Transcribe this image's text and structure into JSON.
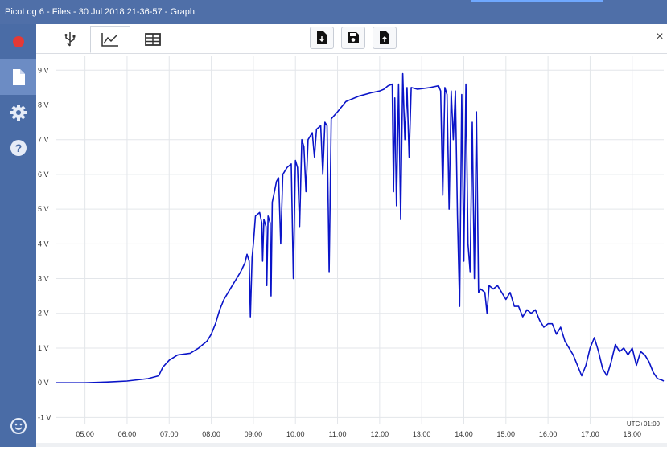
{
  "window": {
    "title": "PicoLog 6 - Files - 30 Jul 2018 21-36-57 - Graph"
  },
  "sidebar": {
    "items": [
      {
        "name": "record-icon",
        "color": "#e53935"
      },
      {
        "name": "file-icon",
        "active": true
      },
      {
        "name": "gear-icon"
      },
      {
        "name": "help-icon"
      },
      {
        "name": "smiley-icon"
      }
    ]
  },
  "toolbar": {
    "tabs": [
      {
        "name": "usb-icon"
      },
      {
        "name": "graph-icon",
        "active": true
      },
      {
        "name": "table-icon"
      }
    ],
    "buttons": [
      {
        "name": "open-file-icon"
      },
      {
        "name": "save-icon"
      },
      {
        "name": "export-icon"
      }
    ],
    "close_label": "×"
  },
  "chart_data": {
    "type": "line",
    "color": "#0a14c8",
    "timezone_label": "UTC+01:00",
    "x_ticks": [
      "05:00",
      "06:00",
      "07:00",
      "08:00",
      "09:00",
      "10:00",
      "11:00",
      "12:00",
      "13:00",
      "14:00",
      "15:00",
      "16:00",
      "17:00",
      "18:00"
    ],
    "y_ticks": [
      "-1 V",
      "0 V",
      "1 V",
      "2 V",
      "3 V",
      "4 V",
      "5 V",
      "6 V",
      "7 V",
      "8 V",
      "9 V"
    ],
    "xlim_hours": [
      4.3,
      18.75
    ],
    "ylim": [
      -1.2,
      9.4
    ],
    "grid": true,
    "series": [
      {
        "points": [
          [
            4.3,
            0
          ],
          [
            5.0,
            0
          ],
          [
            5.5,
            0.02
          ],
          [
            6.0,
            0.05
          ],
          [
            6.5,
            0.12
          ],
          [
            6.75,
            0.2
          ],
          [
            6.85,
            0.45
          ],
          [
            7.0,
            0.65
          ],
          [
            7.2,
            0.8
          ],
          [
            7.5,
            0.85
          ],
          [
            7.7,
            1.0
          ],
          [
            7.9,
            1.2
          ],
          [
            8.0,
            1.4
          ],
          [
            8.1,
            1.7
          ],
          [
            8.2,
            2.1
          ],
          [
            8.3,
            2.4
          ],
          [
            8.4,
            2.6
          ],
          [
            8.5,
            2.8
          ],
          [
            8.6,
            3.0
          ],
          [
            8.7,
            3.2
          ],
          [
            8.8,
            3.45
          ],
          [
            8.85,
            3.7
          ],
          [
            8.9,
            3.5
          ],
          [
            8.93,
            1.9
          ],
          [
            8.97,
            3.6
          ],
          [
            9.0,
            4.0
          ],
          [
            9.05,
            4.8
          ],
          [
            9.15,
            4.9
          ],
          [
            9.2,
            4.6
          ],
          [
            9.22,
            3.5
          ],
          [
            9.25,
            4.7
          ],
          [
            9.3,
            4.5
          ],
          [
            9.32,
            2.8
          ],
          [
            9.35,
            4.8
          ],
          [
            9.4,
            4.6
          ],
          [
            9.42,
            2.5
          ],
          [
            9.45,
            5.2
          ],
          [
            9.5,
            5.5
          ],
          [
            9.55,
            5.8
          ],
          [
            9.6,
            5.9
          ],
          [
            9.65,
            4.0
          ],
          [
            9.7,
            6.0
          ],
          [
            9.8,
            6.2
          ],
          [
            9.9,
            6.3
          ],
          [
            9.95,
            3.0
          ],
          [
            10.0,
            6.4
          ],
          [
            10.05,
            6.2
          ],
          [
            10.1,
            4.5
          ],
          [
            10.15,
            7.0
          ],
          [
            10.2,
            6.8
          ],
          [
            10.25,
            5.5
          ],
          [
            10.3,
            7.0
          ],
          [
            10.4,
            7.2
          ],
          [
            10.45,
            6.5
          ],
          [
            10.5,
            7.3
          ],
          [
            10.6,
            7.4
          ],
          [
            10.65,
            6.0
          ],
          [
            10.7,
            7.5
          ],
          [
            10.75,
            7.4
          ],
          [
            10.8,
            3.2
          ],
          [
            10.85,
            7.6
          ],
          [
            11.0,
            7.8
          ],
          [
            11.2,
            8.1
          ],
          [
            11.5,
            8.25
          ],
          [
            11.8,
            8.35
          ],
          [
            12.0,
            8.4
          ],
          [
            12.1,
            8.45
          ],
          [
            12.2,
            8.55
          ],
          [
            12.3,
            8.6
          ],
          [
            12.33,
            5.5
          ],
          [
            12.36,
            8.2
          ],
          [
            12.4,
            5.1
          ],
          [
            12.45,
            8.6
          ],
          [
            12.5,
            4.7
          ],
          [
            12.55,
            8.9
          ],
          [
            12.6,
            7.0
          ],
          [
            12.65,
            8.5
          ],
          [
            12.7,
            6.5
          ],
          [
            12.75,
            8.5
          ],
          [
            12.9,
            8.45
          ],
          [
            13.2,
            8.5
          ],
          [
            13.4,
            8.55
          ],
          [
            13.45,
            8.4
          ],
          [
            13.5,
            5.4
          ],
          [
            13.55,
            8.5
          ],
          [
            13.6,
            8.3
          ],
          [
            13.65,
            5.0
          ],
          [
            13.7,
            8.4
          ],
          [
            13.75,
            7.0
          ],
          [
            13.8,
            8.4
          ],
          [
            13.85,
            4.8
          ],
          [
            13.9,
            2.2
          ],
          [
            13.95,
            8.3
          ],
          [
            14.0,
            3.5
          ],
          [
            14.05,
            8.6
          ],
          [
            14.1,
            4.0
          ],
          [
            14.15,
            3.2
          ],
          [
            14.2,
            7.5
          ],
          [
            14.25,
            3.0
          ],
          [
            14.3,
            7.8
          ],
          [
            14.35,
            2.6
          ],
          [
            14.4,
            2.7
          ],
          [
            14.5,
            2.6
          ],
          [
            14.55,
            2.0
          ],
          [
            14.6,
            2.8
          ],
          [
            14.7,
            2.7
          ],
          [
            14.8,
            2.8
          ],
          [
            14.9,
            2.6
          ],
          [
            15.0,
            2.4
          ],
          [
            15.1,
            2.6
          ],
          [
            15.2,
            2.2
          ],
          [
            15.3,
            2.2
          ],
          [
            15.4,
            1.9
          ],
          [
            15.5,
            2.1
          ],
          [
            15.6,
            2.0
          ],
          [
            15.7,
            2.1
          ],
          [
            15.8,
            1.8
          ],
          [
            15.9,
            1.6
          ],
          [
            16.0,
            1.7
          ],
          [
            16.1,
            1.7
          ],
          [
            16.2,
            1.4
          ],
          [
            16.3,
            1.6
          ],
          [
            16.4,
            1.2
          ],
          [
            16.5,
            1.0
          ],
          [
            16.6,
            0.8
          ],
          [
            16.7,
            0.5
          ],
          [
            16.8,
            0.2
          ],
          [
            16.9,
            0.5
          ],
          [
            17.0,
            1.0
          ],
          [
            17.1,
            1.3
          ],
          [
            17.2,
            0.9
          ],
          [
            17.3,
            0.4
          ],
          [
            17.4,
            0.2
          ],
          [
            17.5,
            0.6
          ],
          [
            17.6,
            1.1
          ],
          [
            17.7,
            0.9
          ],
          [
            17.8,
            1.0
          ],
          [
            17.9,
            0.8
          ],
          [
            18.0,
            1.0
          ],
          [
            18.1,
            0.5
          ],
          [
            18.2,
            0.9
          ],
          [
            18.3,
            0.8
          ],
          [
            18.4,
            0.6
          ],
          [
            18.5,
            0.3
          ],
          [
            18.6,
            0.12
          ],
          [
            18.7,
            0.08
          ],
          [
            18.75,
            0.05
          ]
        ]
      }
    ]
  }
}
